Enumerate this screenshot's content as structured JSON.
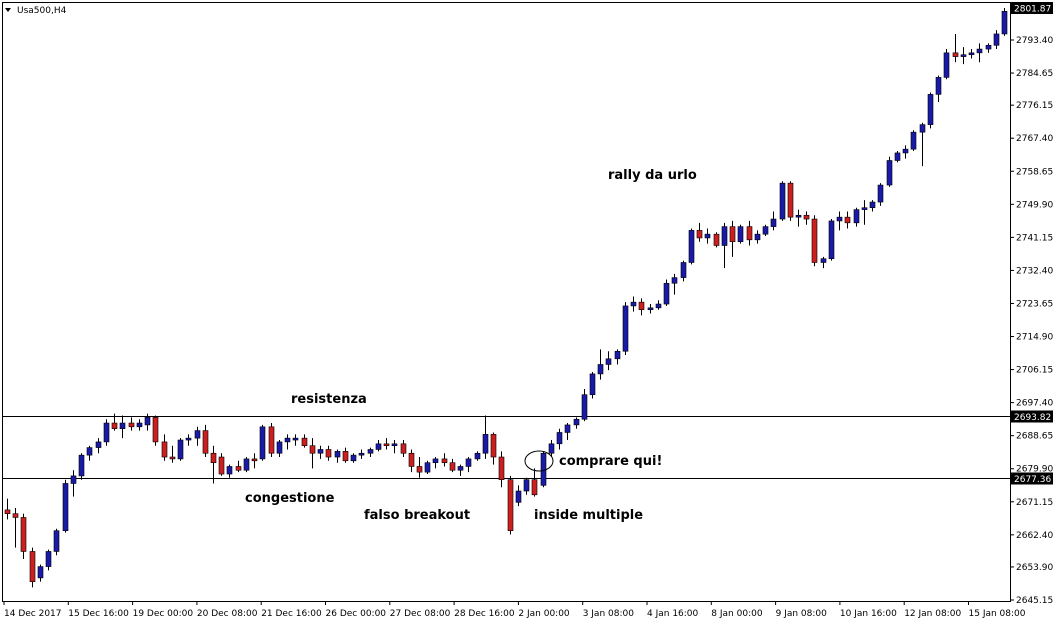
{
  "symbol_title": "Usa500,H4",
  "colors": {
    "up": "#1a1aa8",
    "down": "#cc1f1f",
    "wick": "#000000",
    "level_line": "#000000",
    "price_tag_bg": "#000000",
    "price_tag_text": "#ffffff",
    "background": "#ffffff"
  },
  "chart_data": {
    "type": "candlestick",
    "y_range": [
      2645.15,
      2801.87
    ],
    "y_ticks": [
      "2793.40",
      "2784.65",
      "2776.15",
      "2767.40",
      "2758.65",
      "2749.90",
      "2741.15",
      "2732.40",
      "2723.65",
      "2714.90",
      "2706.15",
      "2697.40",
      "2688.65",
      "2679.90",
      "2671.15",
      "2662.40",
      "2653.90",
      "2645.15"
    ],
    "current_price_label": "2801.87",
    "x_labels": [
      "14 Dec 2017",
      "15 Dec 16:00",
      "19 Dec 00:00",
      "20 Dec 08:00",
      "21 Dec 16:00",
      "26 Dec 00:00",
      "27 Dec 08:00",
      "28 Dec 16:00",
      "2 Jan 00:00",
      "3 Jan 08:00",
      "4 Jan 16:00",
      "8 Jan 00:00",
      "9 Jan 08:00",
      "10 Jan 16:00",
      "12 Jan 08:00",
      "15 Jan 08:00"
    ],
    "levels": [
      {
        "label": "2693.82",
        "value": 2693.82
      },
      {
        "label": "2677.36",
        "value": 2677.36
      }
    ],
    "annotations": [
      "resistenza",
      "congestione",
      "falso breakout",
      "inside multiple",
      "comprare qui!",
      "rally da urlo"
    ],
    "candles": [
      [
        2669.0,
        2672.0,
        2666.5,
        2668.0
      ],
      [
        2668.0,
        2669.5,
        2659.0,
        2667.0
      ],
      [
        2667.0,
        2668.0,
        2656.0,
        2658.0
      ],
      [
        2658.0,
        2659.0,
        2648.5,
        2650.0
      ],
      [
        2651.0,
        2654.5,
        2650.0,
        2654.0
      ],
      [
        2654.0,
        2658.5,
        2653.0,
        2658.0
      ],
      [
        2658.0,
        2664.0,
        2657.0,
        2663.5
      ],
      [
        2663.5,
        2677.0,
        2663.0,
        2676.0
      ],
      [
        2676.0,
        2679.5,
        2672.5,
        2678.0
      ],
      [
        2678.0,
        2684.0,
        2677.0,
        2683.5
      ],
      [
        2683.5,
        2686.0,
        2682.0,
        2685.5
      ],
      [
        2685.5,
        2688.0,
        2684.0,
        2687.0
      ],
      [
        2687.0,
        2693.0,
        2686.0,
        2692.0
      ],
      [
        2692.0,
        2694.5,
        2690.0,
        2690.5
      ],
      [
        2690.5,
        2694.0,
        2688.0,
        2692.0
      ],
      [
        2692.0,
        2693.5,
        2690.0,
        2691.0
      ],
      [
        2691.0,
        2693.0,
        2690.0,
        2692.0
      ],
      [
        2691.5,
        2694.5,
        2690.0,
        2693.5
      ],
      [
        2693.5,
        2694.0,
        2686.0,
        2687.0
      ],
      [
        2687.0,
        2689.0,
        2682.0,
        2683.0
      ],
      [
        2683.0,
        2686.0,
        2681.5,
        2682.5
      ],
      [
        2682.5,
        2688.0,
        2682.0,
        2687.5
      ],
      [
        2687.5,
        2689.0,
        2686.0,
        2688.0
      ],
      [
        2688.0,
        2691.0,
        2686.0,
        2690.0
      ],
      [
        2690.0,
        2691.5,
        2683.0,
        2684.0
      ],
      [
        2684.0,
        2686.0,
        2676.0,
        2681.5
      ],
      [
        2683.0,
        2684.0,
        2678.0,
        2678.5
      ],
      [
        2678.5,
        2681.0,
        2677.5,
        2680.5
      ],
      [
        2680.5,
        2682.0,
        2679.0,
        2679.5
      ],
      [
        2679.5,
        2683.0,
        2679.0,
        2682.5
      ],
      [
        2682.5,
        2684.0,
        2680.0,
        2682.0
      ],
      [
        2682.5,
        2691.5,
        2682.0,
        2691.0
      ],
      [
        2691.0,
        2692.0,
        2683.0,
        2684.0
      ],
      [
        2684.0,
        2687.5,
        2683.0,
        2687.0
      ],
      [
        2687.0,
        2689.0,
        2685.0,
        2688.0
      ],
      [
        2687.5,
        2689.0,
        2686.0,
        2688.0
      ],
      [
        2688.0,
        2689.0,
        2685.5,
        2686.0
      ],
      [
        2686.0,
        2688.0,
        2680.0,
        2684.0
      ],
      [
        2684.0,
        2686.0,
        2682.5,
        2685.0
      ],
      [
        2685.0,
        2686.0,
        2682.0,
        2683.0
      ],
      [
        2683.0,
        2685.0,
        2681.5,
        2684.5
      ],
      [
        2684.5,
        2685.5,
        2681.5,
        2682.0
      ],
      [
        2682.0,
        2684.0,
        2681.5,
        2683.5
      ],
      [
        2683.5,
        2685.0,
        2682.5,
        2684.0
      ],
      [
        2684.0,
        2685.5,
        2683.0,
        2685.0
      ],
      [
        2685.0,
        2687.5,
        2684.5,
        2686.5
      ],
      [
        2686.5,
        2688.0,
        2685.0,
        2686.0
      ],
      [
        2686.0,
        2687.5,
        2684.0,
        2686.5
      ],
      [
        2686.5,
        2687.5,
        2683.0,
        2684.0
      ],
      [
        2684.0,
        2685.0,
        2679.0,
        2680.5
      ],
      [
        2680.5,
        2683.0,
        2677.5,
        2679.0
      ],
      [
        2679.0,
        2682.0,
        2678.5,
        2681.5
      ],
      [
        2681.5,
        2683.0,
        2680.0,
        2682.5
      ],
      [
        2682.5,
        2684.0,
        2680.5,
        2681.5
      ],
      [
        2681.5,
        2682.5,
        2679.0,
        2679.5
      ],
      [
        2679.5,
        2681.0,
        2678.0,
        2680.5
      ],
      [
        2680.5,
        2683.0,
        2679.0,
        2682.5
      ],
      [
        2682.5,
        2684.5,
        2682.0,
        2684.0
      ],
      [
        2684.0,
        2694.0,
        2682.5,
        2689.0
      ],
      [
        2689.0,
        2689.5,
        2681.0,
        2683.0
      ],
      [
        2683.0,
        2684.5,
        2675.0,
        2677.0
      ],
      [
        2677.0,
        2678.0,
        2662.5,
        2663.5
      ],
      [
        2671.0,
        2675.5,
        2670.0,
        2674.0
      ],
      [
        2674.0,
        2677.5,
        2673.0,
        2677.0
      ],
      [
        2677.0,
        2680.0,
        2672.5,
        2673.0
      ],
      [
        2675.5,
        2684.5,
        2675.0,
        2684.0
      ],
      [
        2684.0,
        2687.5,
        2683.0,
        2686.5
      ],
      [
        2686.5,
        2690.5,
        2685.0,
        2689.5
      ],
      [
        2689.5,
        2692.0,
        2687.5,
        2691.5
      ],
      [
        2691.5,
        2693.5,
        2690.5,
        2693.0
      ],
      [
        2693.0,
        2701.0,
        2692.5,
        2699.5
      ],
      [
        2699.5,
        2705.5,
        2698.5,
        2705.0
      ],
      [
        2705.0,
        2711.5,
        2703.5,
        2707.5
      ],
      [
        2707.5,
        2711.0,
        2706.0,
        2709.0
      ],
      [
        2709.0,
        2711.5,
        2707.5,
        2711.0
      ],
      [
        2711.0,
        2724.0,
        2710.0,
        2723.0
      ],
      [
        2723.0,
        2725.5,
        2721.5,
        2724.0
      ],
      [
        2724.0,
        2725.0,
        2720.5,
        2722.0
      ],
      [
        2722.0,
        2723.5,
        2721.0,
        2722.5
      ],
      [
        2722.5,
        2724.5,
        2722.0,
        2723.5
      ],
      [
        2723.5,
        2730.0,
        2723.0,
        2729.0
      ],
      [
        2729.0,
        2731.5,
        2726.0,
        2730.5
      ],
      [
        2730.5,
        2735.0,
        2729.5,
        2734.5
      ],
      [
        2734.5,
        2743.5,
        2734.0,
        2743.0
      ],
      [
        2743.0,
        2745.0,
        2740.0,
        2741.0
      ],
      [
        2741.0,
        2743.5,
        2739.5,
        2742.0
      ],
      [
        2742.0,
        2742.5,
        2738.5,
        2739.0
      ],
      [
        2739.0,
        2745.0,
        2733.0,
        2744.0
      ],
      [
        2744.0,
        2745.5,
        2736.0,
        2740.0
      ],
      [
        2740.0,
        2744.5,
        2739.5,
        2744.0
      ],
      [
        2744.0,
        2745.5,
        2739.0,
        2740.5
      ],
      [
        2740.5,
        2743.0,
        2739.5,
        2742.0
      ],
      [
        2742.0,
        2744.5,
        2741.5,
        2744.0
      ],
      [
        2744.0,
        2748.0,
        2743.0,
        2746.0
      ],
      [
        2746.0,
        2756.0,
        2745.5,
        2755.5
      ],
      [
        2755.5,
        2756.0,
        2745.5,
        2746.5
      ],
      [
        2746.5,
        2748.5,
        2744.0,
        2747.0
      ],
      [
        2747.0,
        2748.0,
        2744.5,
        2746.0
      ],
      [
        2746.0,
        2747.0,
        2733.5,
        2734.5
      ],
      [
        2734.5,
        2736.0,
        2733.0,
        2735.5
      ],
      [
        2735.5,
        2746.0,
        2735.0,
        2745.5
      ],
      [
        2745.5,
        2748.0,
        2743.0,
        2746.5
      ],
      [
        2746.5,
        2748.0,
        2743.5,
        2745.0
      ],
      [
        2745.0,
        2749.0,
        2744.0,
        2748.5
      ],
      [
        2748.5,
        2751.0,
        2744.5,
        2749.0
      ],
      [
        2749.0,
        2751.0,
        2748.0,
        2750.5
      ],
      [
        2750.5,
        2755.5,
        2749.5,
        2755.0
      ],
      [
        2755.0,
        2762.5,
        2754.5,
        2761.5
      ],
      [
        2761.5,
        2764.0,
        2761.0,
        2763.5
      ],
      [
        2763.5,
        2765.5,
        2762.0,
        2764.5
      ],
      [
        2764.5,
        2769.5,
        2764.0,
        2769.0
      ],
      [
        2769.0,
        2771.5,
        2760.0,
        2771.0
      ],
      [
        2771.0,
        2779.5,
        2770.0,
        2779.0
      ],
      [
        2779.0,
        2784.0,
        2777.0,
        2783.5
      ],
      [
        2783.5,
        2791.0,
        2783.0,
        2790.0
      ],
      [
        2790.0,
        2795.0,
        2787.5,
        2789.0
      ],
      [
        2789.0,
        2791.5,
        2787.0,
        2789.5
      ],
      [
        2789.5,
        2791.0,
        2788.5,
        2790.0
      ],
      [
        2790.0,
        2792.5,
        2787.5,
        2791.0
      ],
      [
        2791.0,
        2792.5,
        2790.0,
        2792.0
      ],
      [
        2792.0,
        2796.0,
        2791.0,
        2795.0
      ],
      [
        2795.0,
        2801.87,
        2794.5,
        2801.0
      ]
    ]
  }
}
